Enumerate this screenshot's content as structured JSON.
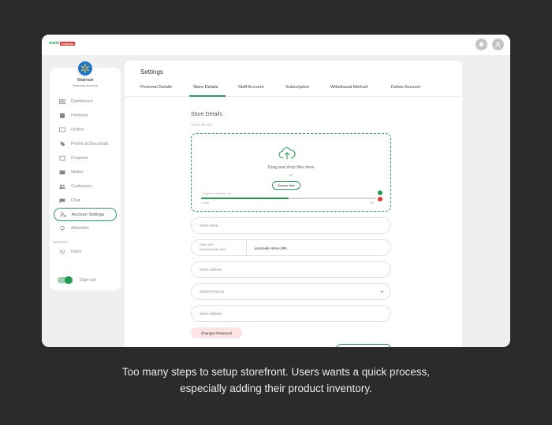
{
  "app": {
    "logo_text": "mami",
    "logo_tag": "markets"
  },
  "sidebar": {
    "brand_name": "Walmart",
    "brand_sub": "Business Account",
    "items": [
      {
        "label": "Dashboard",
        "icon": "dashboard-icon"
      },
      {
        "label": "Products",
        "icon": "products-icon"
      },
      {
        "label": "Orders",
        "icon": "orders-icon"
      },
      {
        "label": "Promo & Discounts",
        "icon": "tag-icon"
      },
      {
        "label": "Coupons",
        "icon": "coupon-icon"
      },
      {
        "label": "Wallet",
        "icon": "wallet-icon"
      },
      {
        "label": "Customers",
        "icon": "customers-icon"
      },
      {
        "label": "Chat",
        "icon": "chat-icon"
      },
      {
        "label": "Account Settings",
        "icon": "account-settings-icon",
        "active": true
      },
      {
        "label": "Advertise",
        "icon": "advertise-icon"
      }
    ],
    "support_label": "SUPPORT",
    "inbox_label": "Inbox",
    "signout_label": "Sign out"
  },
  "settings": {
    "title": "Settings",
    "tabs": [
      "Personal Details",
      "Store Details",
      "Staff Account",
      "Subscription",
      "Withdrawal Method",
      "Delete Account"
    ],
    "active_tab": "Store Details"
  },
  "store": {
    "section_title": "Store Details",
    "avatar_label": "Store Avatar",
    "drop_text": "Drag and drop files here",
    "or_text": "or",
    "browse_label": "Browse files",
    "file_name": "Tungchoo-Avatar.png",
    "progress_left": "0.0MB",
    "progress_right": "70%",
    "progress": 0.5,
    "store_name_placeholder": "Store name",
    "url_prefix_1": "Store URL",
    "url_prefix_2": "mamimarkets.com/",
    "url_value": "automatic-store-URL",
    "address_placeholder": "Store Address",
    "province_placeholder": "Select Province",
    "address2_placeholder": "Store Address",
    "password_button": "Changes Password"
  },
  "caption": {
    "line1": "Too many steps to setup storefront. Users wants a quick process,",
    "line2": "especially adding their product inventory."
  },
  "colors": {
    "accent": "#2e9e5b",
    "error": "#e53935",
    "background": "#2b2b2b"
  }
}
